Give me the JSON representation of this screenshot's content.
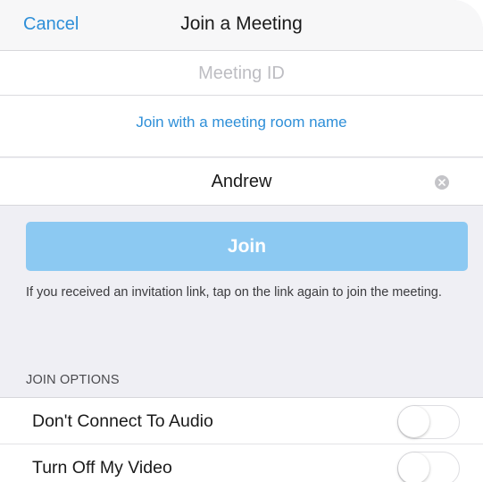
{
  "nav": {
    "cancel_label": "Cancel",
    "title": "Join a Meeting"
  },
  "meeting_id": {
    "placeholder": "Meeting ID",
    "value": ""
  },
  "room_link": {
    "label": "Join with a meeting room name"
  },
  "name_field": {
    "value": "Andrew"
  },
  "join_button": {
    "label": "Join",
    "color": "#8cc9f2"
  },
  "hint": {
    "text": "If you received an invitation link, tap on the link again to join the meeting."
  },
  "join_options": {
    "header": "JOIN OPTIONS",
    "items": [
      {
        "label": "Don't Connect To Audio",
        "enabled": false
      },
      {
        "label": "Turn Off My Video",
        "enabled": false
      }
    ]
  },
  "colors": {
    "accent": "#2e8fd8",
    "background": "#efeff4"
  },
  "icons": {
    "clear": "clear-circle-icon"
  }
}
